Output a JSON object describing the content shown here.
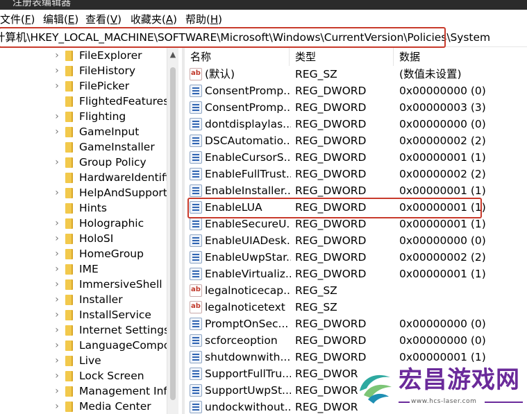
{
  "window": {
    "title": "注册表编辑器"
  },
  "menu": [
    {
      "label": "文件(",
      "key": "F",
      "suffix": ")"
    },
    {
      "label": "编辑(",
      "key": "E",
      "suffix": ")"
    },
    {
      "label": "查看(",
      "key": "V",
      "suffix": ")"
    },
    {
      "label": "收藏夹(",
      "key": "A",
      "suffix": ")"
    },
    {
      "label": "帮助(",
      "key": "H",
      "suffix": ")"
    }
  ],
  "address": "计算机\\HKEY_LOCAL_MACHINE\\SOFTWARE\\Microsoft\\Windows\\CurrentVersion\\Policies\\System",
  "tree": [
    {
      "label": "FileExplorer",
      "expandable": true
    },
    {
      "label": "FileHistory",
      "expandable": true
    },
    {
      "label": "FilePicker",
      "expandable": true
    },
    {
      "label": "FlightedFeatures",
      "expandable": false
    },
    {
      "label": "Flighting",
      "expandable": true
    },
    {
      "label": "GameInput",
      "expandable": true
    },
    {
      "label": "GameInstaller",
      "expandable": false
    },
    {
      "label": "Group Policy",
      "expandable": true
    },
    {
      "label": "HardwareIdentifi",
      "expandable": false
    },
    {
      "label": "HelpAndSupport",
      "expandable": true
    },
    {
      "label": "Hints",
      "expandable": false
    },
    {
      "label": "Holographic",
      "expandable": true
    },
    {
      "label": "HoloSI",
      "expandable": true
    },
    {
      "label": "HomeGroup",
      "expandable": true
    },
    {
      "label": "IME",
      "expandable": true
    },
    {
      "label": "ImmersiveShell",
      "expandable": true
    },
    {
      "label": "Installer",
      "expandable": true
    },
    {
      "label": "InstallService",
      "expandable": true
    },
    {
      "label": "Internet Settings",
      "expandable": true
    },
    {
      "label": "LanguageCompo",
      "expandable": true
    },
    {
      "label": "Live",
      "expandable": true
    },
    {
      "label": "Lock Screen",
      "expandable": true
    },
    {
      "label": "Management Infr",
      "expandable": true
    },
    {
      "label": "Media Center",
      "expandable": true
    }
  ],
  "columns": {
    "name": "名称",
    "type": "类型",
    "data": "数据"
  },
  "values": [
    {
      "icon": "string",
      "name": "(默认)",
      "type": "REG_SZ",
      "data": "(数值未设置)"
    },
    {
      "icon": "binary",
      "name": "ConsentPromp...",
      "type": "REG_DWORD",
      "data": "0x00000000 (0)"
    },
    {
      "icon": "binary",
      "name": "ConsentPromp...",
      "type": "REG_DWORD",
      "data": "0x00000003 (3)"
    },
    {
      "icon": "binary",
      "name": "dontdisplaylas...",
      "type": "REG_DWORD",
      "data": "0x00000000 (0)"
    },
    {
      "icon": "binary",
      "name": "DSCAutomatio...",
      "type": "REG_DWORD",
      "data": "0x00000002 (2)"
    },
    {
      "icon": "binary",
      "name": "EnableCursorS...",
      "type": "REG_DWORD",
      "data": "0x00000001 (1)"
    },
    {
      "icon": "binary",
      "name": "EnableFullTrust...",
      "type": "REG_DWORD",
      "data": "0x00000002 (2)"
    },
    {
      "icon": "binary",
      "name": "EnableInstaller...",
      "type": "REG_DWORD",
      "data": "0x00000001 (1)"
    },
    {
      "icon": "binary",
      "name": "EnableLUA",
      "type": "REG_DWORD",
      "data": "0x00000001 (1)"
    },
    {
      "icon": "binary",
      "name": "EnableSecureU...",
      "type": "REG_DWORD",
      "data": "0x00000001 (1)"
    },
    {
      "icon": "binary",
      "name": "EnableUIADesk...",
      "type": "REG_DWORD",
      "data": "0x00000000 (0)"
    },
    {
      "icon": "binary",
      "name": "EnableUwpStar...",
      "type": "REG_DWORD",
      "data": "0x00000002 (2)"
    },
    {
      "icon": "binary",
      "name": "EnableVirtualiz...",
      "type": "REG_DWORD",
      "data": "0x00000001 (1)"
    },
    {
      "icon": "string",
      "name": "legalnoticecap...",
      "type": "REG_SZ",
      "data": ""
    },
    {
      "icon": "string",
      "name": "legalnoticetext",
      "type": "REG_SZ",
      "data": ""
    },
    {
      "icon": "binary",
      "name": "PromptOnSec...",
      "type": "REG_DWORD",
      "data": "0x00000000 (0)"
    },
    {
      "icon": "binary",
      "name": "scforceoption",
      "type": "REG_DWORD",
      "data": "0x00000000 (0)"
    },
    {
      "icon": "binary",
      "name": "shutdownwith...",
      "type": "REG_DWORD",
      "data": "0x00000001 (1)"
    },
    {
      "icon": "binary",
      "name": "SupportFullTru...",
      "type": "REG_DWOR",
      "data": ""
    },
    {
      "icon": "binary",
      "name": "SupportUwpSt...",
      "type": "REG_DWOR",
      "data": ""
    },
    {
      "icon": "binary",
      "name": "undockwithout...",
      "type": "REG_DWOR",
      "data": ""
    }
  ],
  "watermark": {
    "title": "宏昌游戏网",
    "url": "www.hcs-laser.com"
  },
  "colors": {
    "highlight_border": "#c83a2b",
    "watermark": "#6a2a9a",
    "folder": "#f2c94c"
  }
}
